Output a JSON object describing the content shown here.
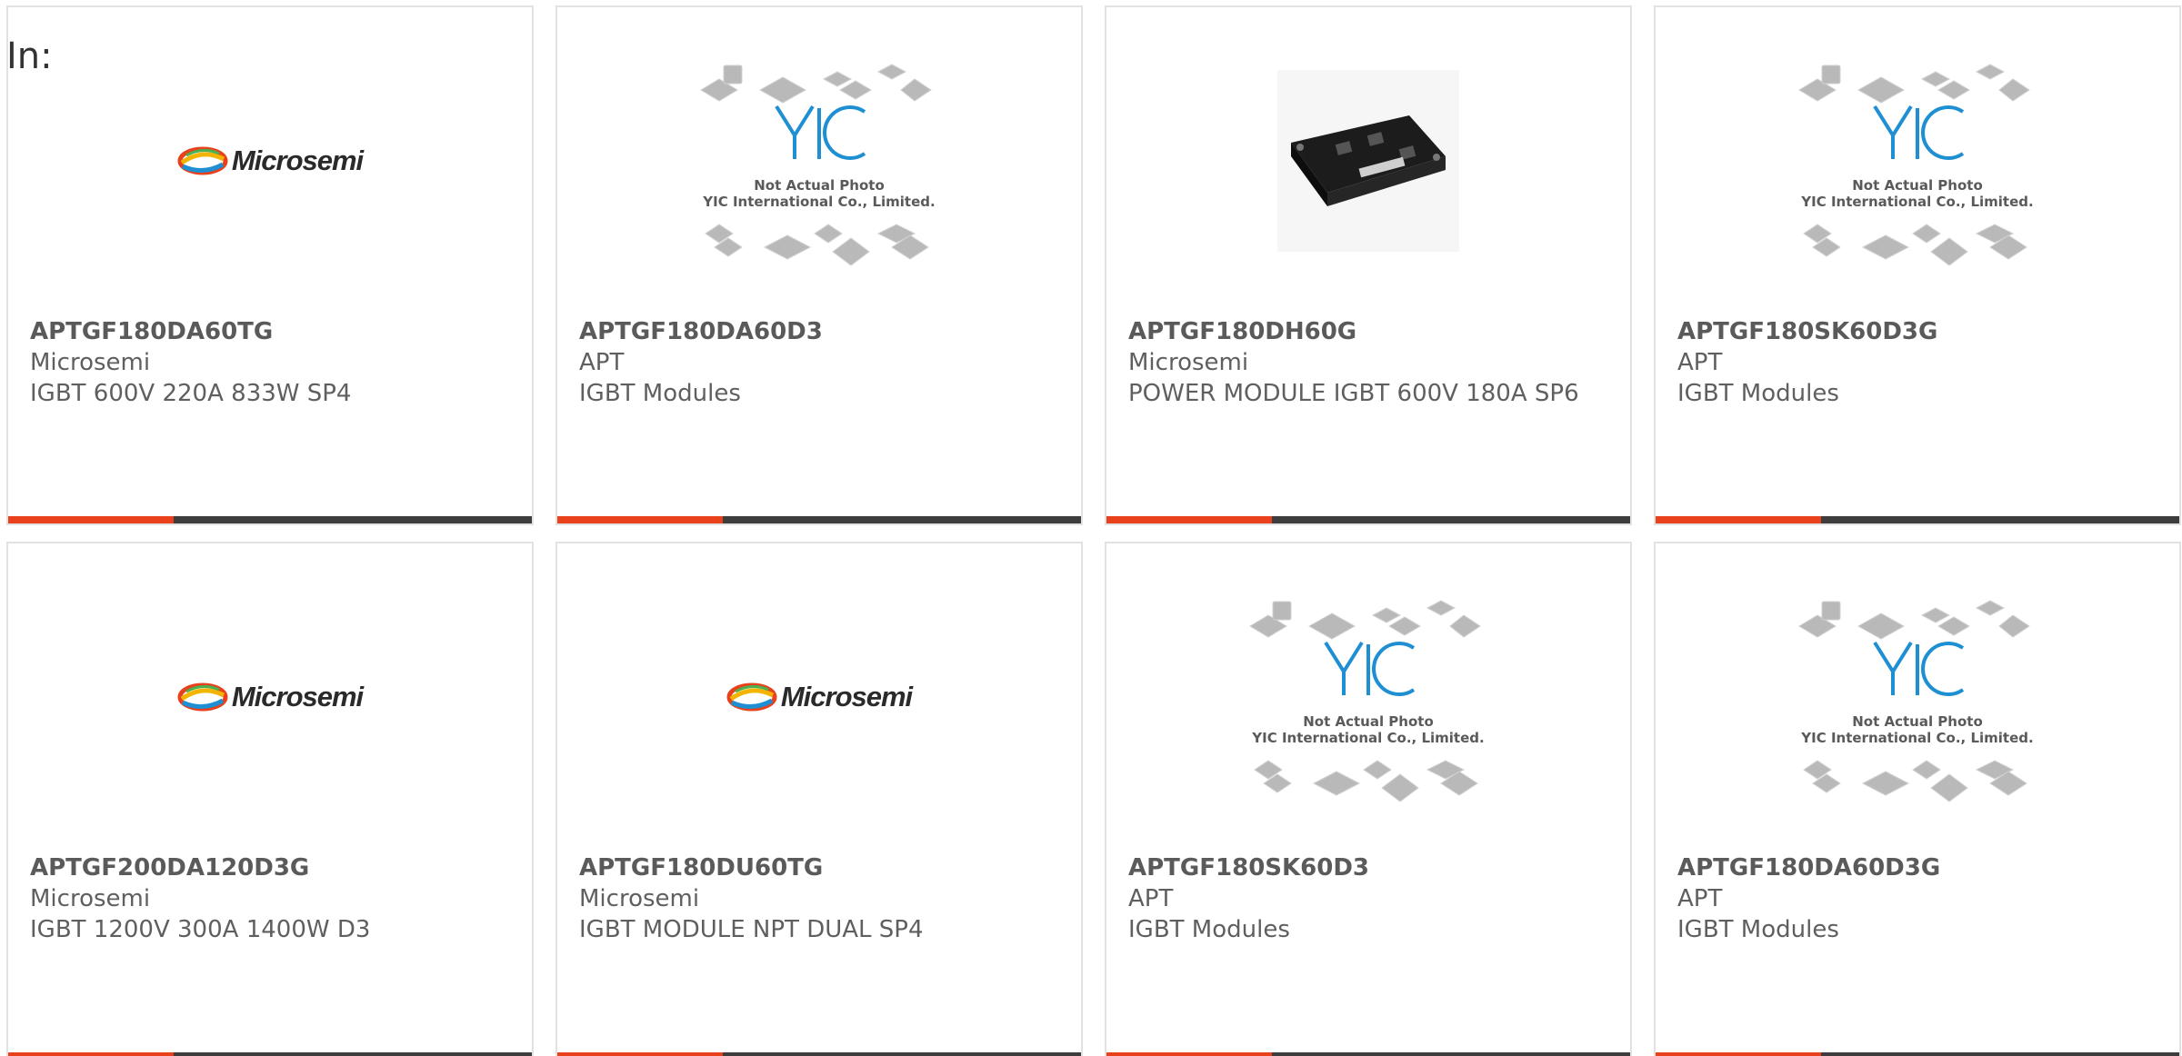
{
  "header": {
    "label": "In:"
  },
  "colors": {
    "accent": "#e8411c",
    "bar": "#3d3d3d",
    "border": "#e2e2e2",
    "yic_blue": "#1e8fd2"
  },
  "placeholder_image": {
    "brand": "YIC",
    "line1": "Not Actual Photo",
    "line2": "YIC International Co., Limited."
  },
  "logo": {
    "microsemi": "Microsemi"
  },
  "products": [
    {
      "part_number": "APTGF180DA60TG",
      "manufacturer": "Microsemi",
      "description": "IGBT 600V 220A 833W SP4",
      "image": "microsemi-logo"
    },
    {
      "part_number": "APTGF180DA60D3",
      "manufacturer": "APT",
      "description": "IGBT Modules",
      "image": "not-actual-photo"
    },
    {
      "part_number": "APTGF180DH60G",
      "manufacturer": "Microsemi",
      "description": "POWER MODULE IGBT 600V 180A SP6",
      "image": "product-photo"
    },
    {
      "part_number": "APTGF180SK60D3G",
      "manufacturer": "APT",
      "description": "IGBT Modules",
      "image": "not-actual-photo"
    },
    {
      "part_number": "APTGF200DA120D3G",
      "manufacturer": "Microsemi",
      "description": "IGBT 1200V 300A 1400W D3",
      "image": "microsemi-logo"
    },
    {
      "part_number": "APTGF180DU60TG",
      "manufacturer": "Microsemi",
      "description": "IGBT MODULE NPT DUAL SP4",
      "image": "microsemi-logo"
    },
    {
      "part_number": "APTGF180SK60D3",
      "manufacturer": "APT",
      "description": "IGBT Modules",
      "image": "not-actual-photo"
    },
    {
      "part_number": "APTGF180DA60D3G",
      "manufacturer": "APT",
      "description": "IGBT Modules",
      "image": "not-actual-photo"
    }
  ]
}
